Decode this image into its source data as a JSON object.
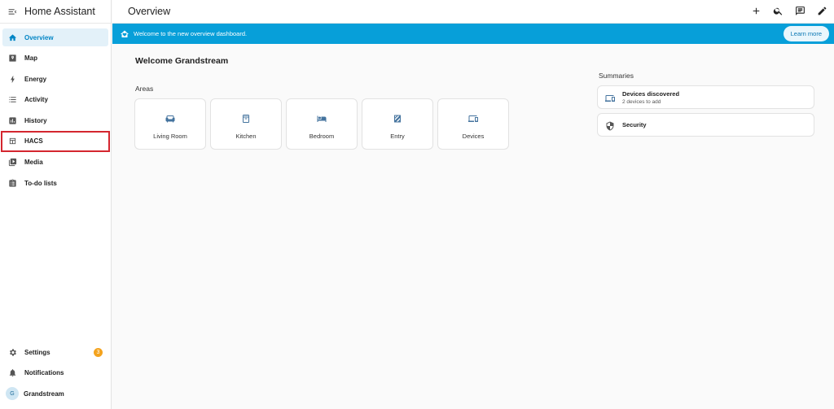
{
  "app": {
    "title": "Home Assistant"
  },
  "sidebar": {
    "items": [
      {
        "label": "Overview",
        "icon": "home-icon"
      },
      {
        "label": "Map",
        "icon": "map-icon"
      },
      {
        "label": "Energy",
        "icon": "lightning-icon"
      },
      {
        "label": "Activity",
        "icon": "list-icon"
      },
      {
        "label": "History",
        "icon": "chart-icon"
      },
      {
        "label": "HACS",
        "icon": "hacs-icon"
      },
      {
        "label": "Media",
        "icon": "media-icon"
      },
      {
        "label": "To-do lists",
        "icon": "clipboard-icon"
      }
    ],
    "bottom": {
      "settings_label": "Settings",
      "settings_badge": "3",
      "notifications_label": "Notifications",
      "user_label": "Grandstream",
      "user_initial": "G"
    }
  },
  "topbar": {
    "title": "Overview"
  },
  "banner": {
    "text": "Welcome to the new overview dashboard.",
    "button": "Learn more"
  },
  "main": {
    "welcome": "Welcome Grandstream",
    "areas_title": "Areas",
    "areas": [
      {
        "label": "Living Room",
        "icon": "sofa-icon"
      },
      {
        "label": "Kitchen",
        "icon": "stove-icon"
      },
      {
        "label": "Bedroom",
        "icon": "bed-icon"
      },
      {
        "label": "Entry",
        "icon": "entry-icon"
      },
      {
        "label": "Devices",
        "icon": "devices-icon"
      }
    ],
    "summaries_title": "Summaries",
    "summaries": [
      {
        "title": "Devices discovered",
        "subtitle": "2 devices to add",
        "icon": "devices-discovered-icon"
      },
      {
        "title": "Security",
        "subtitle": "",
        "icon": "shield-icon"
      }
    ]
  },
  "colors": {
    "accent": "#079fd9",
    "active_text": "#0285c5",
    "badge": "#f4a31e",
    "highlight_border": "#d4262f",
    "icon": "#44739e"
  }
}
